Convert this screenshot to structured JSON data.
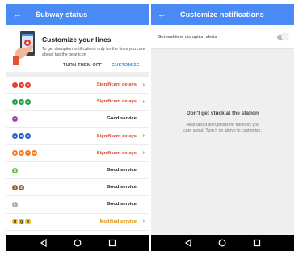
{
  "left_screen": {
    "title": "Subway status",
    "promo": {
      "title": "Customize your lines",
      "body": "To get disruption notifications only for the lines you care about, tap the gear icon",
      "turn_off_label": "TURN THEM OFF",
      "customize_label": "CUSTOMIZE"
    },
    "lines": [
      {
        "bullets": [
          {
            "label": "1",
            "color": "#e8372c"
          },
          {
            "label": "2",
            "color": "#e8372c"
          },
          {
            "label": "3",
            "color": "#e8372c"
          }
        ],
        "status": "Significant delays",
        "status_color": "#d9472e",
        "chevron": true
      },
      {
        "bullets": [
          {
            "label": "4",
            "color": "#1b9e46"
          },
          {
            "label": "5",
            "color": "#1b9e46"
          },
          {
            "label": "6",
            "color": "#1b9e46"
          }
        ],
        "status": "Significant delays",
        "status_color": "#d9472e",
        "chevron": true
      },
      {
        "bullets": [
          {
            "label": "7",
            "color": "#a442b5"
          }
        ],
        "status": "Good service",
        "status_color": "#222222",
        "chevron": false
      },
      {
        "bullets": [
          {
            "label": "A",
            "color": "#2563c4"
          },
          {
            "label": "C",
            "color": "#2563c4"
          },
          {
            "label": "E",
            "color": "#2563c4"
          }
        ],
        "status": "Significant delays",
        "status_color": "#d9472e",
        "chevron": true
      },
      {
        "bullets": [
          {
            "label": "B",
            "color": "#f47b20"
          },
          {
            "label": "D",
            "color": "#f47b20"
          },
          {
            "label": "F",
            "color": "#f47b20"
          },
          {
            "label": "M",
            "color": "#f47b20"
          }
        ],
        "status": "Significant delays",
        "status_color": "#d9472e",
        "chevron": true
      },
      {
        "bullets": [
          {
            "label": "G",
            "color": "#6cbe45"
          }
        ],
        "status": "Good service",
        "status_color": "#222222",
        "chevron": false
      },
      {
        "bullets": [
          {
            "label": "J",
            "color": "#996633"
          },
          {
            "label": "Z",
            "color": "#996633"
          }
        ],
        "status": "Good service",
        "status_color": "#222222",
        "chevron": false
      },
      {
        "bullets": [
          {
            "label": "L",
            "color": "#a7a9ac"
          }
        ],
        "status": "Good service",
        "status_color": "#222222",
        "chevron": false
      },
      {
        "bullets": [
          {
            "label": "N",
            "color": "#f7c41a"
          },
          {
            "label": "Q",
            "color": "#f7c41a"
          },
          {
            "label": "R",
            "color": "#f7c41a"
          }
        ],
        "status": "Modified service",
        "status_color": "#e08a00",
        "chevron": true
      }
    ]
  },
  "right_screen": {
    "title": "Customize notifications",
    "toggle_label": "Get real-time disruption alerts",
    "toggle_on": false,
    "empty_title": "Don't get stuck at the station",
    "empty_body": "Hear about disruptions for the lines you care about. Turn it on above to customize."
  },
  "colors": {
    "app_bar": "#4a8af4",
    "accent": "#4a8af4",
    "nav_bar": "#000000"
  },
  "icons": {
    "back": "arrow-left-icon",
    "chevron": "chevron-right-icon",
    "nav_back": "triangle-back-icon",
    "nav_home": "circle-home-icon",
    "nav_recents": "square-recents-icon"
  }
}
